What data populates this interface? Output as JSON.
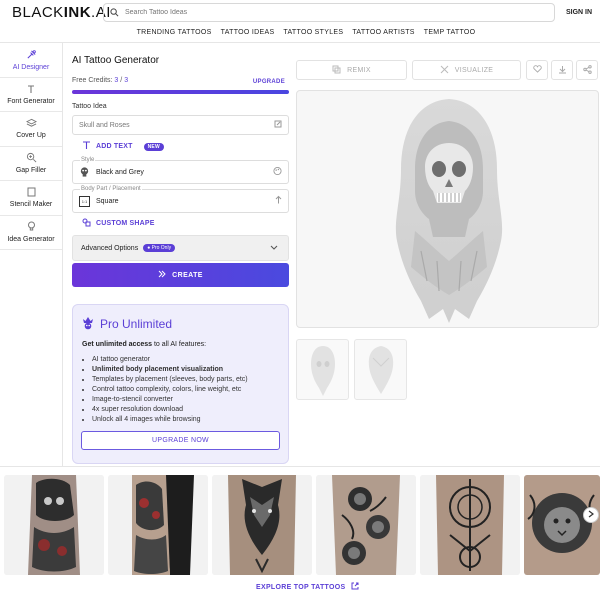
{
  "header": {
    "logo_light": "BLACK",
    "logo_bold": "INK",
    "logo_suffix": ".AI",
    "search_placeholder": "Search Tattoo Ideas",
    "signin": "SIGN IN"
  },
  "nav": [
    "TRENDING TATTOOS",
    "TATTOO IDEAS",
    "TATTOO STYLES",
    "TATTOO ARTISTS",
    "TEMP TATTOO"
  ],
  "sidebar": {
    "items": [
      {
        "label": "AI Designer",
        "icon": "designer-icon",
        "active": true
      },
      {
        "label": "Font Generator",
        "icon": "font-icon",
        "active": false
      },
      {
        "label": "Cover Up",
        "icon": "layers-icon",
        "active": false
      },
      {
        "label": "Gap Filler",
        "icon": "gap-filler-icon",
        "active": false
      },
      {
        "label": "Stencil Maker",
        "icon": "stencil-icon",
        "active": false
      },
      {
        "label": "Idea Generator",
        "icon": "lightbulb-icon",
        "active": false
      }
    ]
  },
  "form": {
    "title": "AI Tattoo Generator",
    "credits_label": "Free Credits:",
    "credits_used": "3",
    "credits_sep": "/",
    "credits_total": "3",
    "credits_fraction": 1.0,
    "upgrade": "UPGRADE",
    "idea_label": "Tattoo Idea",
    "idea_placeholder": "Skull and Roses",
    "add_text": "ADD TEXT",
    "new_badge": "NEW",
    "style_label": "Style",
    "style_value": "Black and Grey",
    "placement_label": "Body Part / Placement",
    "placement_value": "Square",
    "placement_icon_text": "1:1",
    "custom_shape": "CUSTOM SHAPE",
    "advanced": "Advanced Options",
    "pro_only": "Pro Only",
    "create": "CREATE"
  },
  "pro": {
    "title": "Pro Unlimited",
    "sub_bold": "Get unlimited access",
    "sub_rest": " to all AI features:",
    "features": [
      {
        "text": "AI tattoo generator",
        "bold": false
      },
      {
        "text": "Unlimited body placement visualization",
        "bold": true
      },
      {
        "text": "Templates by placement (sleeves, body parts, etc)",
        "bold": false
      },
      {
        "text": "Control tattoo complexity, colors, line weight, etc",
        "bold": false
      },
      {
        "text": "Image-to-stencil converter",
        "bold": false
      },
      {
        "text": "4x super resolution download",
        "bold": false
      },
      {
        "text": "Unlock all 4 images while browsing",
        "bold": false
      }
    ],
    "upgrade_now": "UPGRADE NOW"
  },
  "preview": {
    "remix": "REMIX",
    "visualize": "VISUALIZE"
  },
  "gallery": {
    "explore": "EXPLORE TOP TATTOOS"
  },
  "colors": {
    "accent": "#5b3fd6",
    "accent_dark": "#4a46e0",
    "pro_bg": "#efeefc"
  }
}
